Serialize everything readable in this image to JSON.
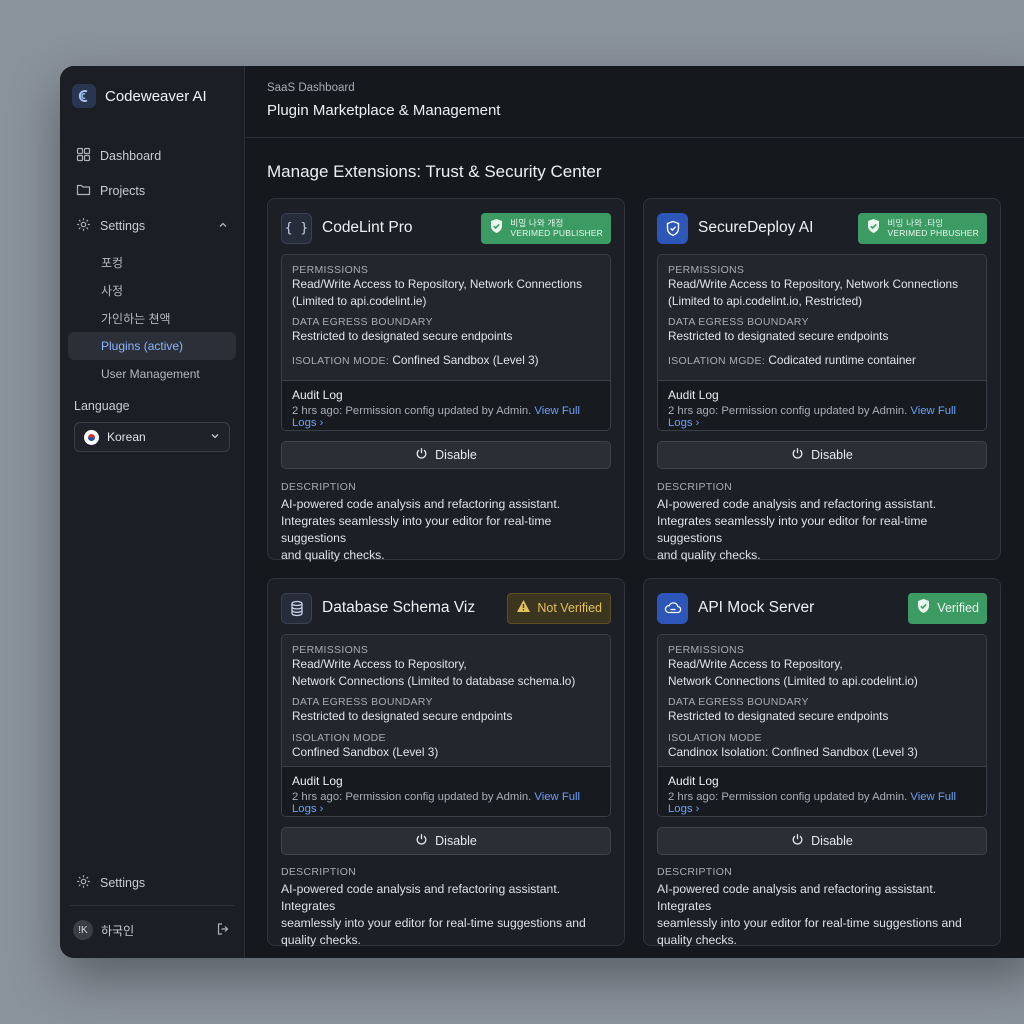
{
  "app": {
    "name": "Codeweaver AI"
  },
  "sidebar": {
    "nav": [
      {
        "label": "Dashboard",
        "icon": "grid-icon"
      },
      {
        "label": "Projects",
        "icon": "folder-icon"
      },
      {
        "label": "Settings",
        "icon": "gear-icon"
      }
    ],
    "sub_items": [
      {
        "label": "포컹"
      },
      {
        "label": "사정"
      },
      {
        "label": "가인하는 쳔액"
      },
      {
        "label": "Plugins (active)",
        "active": true
      },
      {
        "label": "User Management"
      }
    ],
    "language_label": "Language",
    "language_value": "Korean",
    "bottom_settings": "Settings",
    "user_initial": "!K",
    "user_name": "하국인"
  },
  "header": {
    "breadcrumb": "SaaS Dashboard",
    "title": "Plugin Marketplace & Management"
  },
  "section_title": "Manage Extensions: Trust & Security Center",
  "cards": [
    {
      "name": "CodeLint Pro",
      "icon": "braces-icon",
      "badge_type": "ok",
      "badge_line1": "비밀 나와 개정",
      "badge_line2": "VERIMED PUBLISHER",
      "permissions_label": "PERMISSIONS",
      "permissions_line1": "Read/Write Access to Repository, Network Connections",
      "permissions_line2": "(Limited to api.codelint.ie)",
      "egress_label": "DATA EGRESS BOUNDARY",
      "egress_value": "Restricted to designated secure endpoints",
      "isolation_label": "ISOLATION MODE:",
      "isolation_value": "Confined Sandbox (Level 3)",
      "audit_title": "Audit Log",
      "audit_text": "2 hrs ago: Permission config updated by Admin.",
      "audit_link": "View Full Logs",
      "disable_label": "Disable",
      "desc_label": "DESCRIPTION",
      "desc_line1": "AI-powered code analysis and refactoring assistant.",
      "desc_line2": "Integrates seamlessly into your editor for real-time suggestions",
      "desc_line3": "and quality checks."
    },
    {
      "name": "SecureDeploy AI",
      "icon": "shield-icon",
      "badge_type": "ok",
      "badge_line1": "비밍 나와 .타잉",
      "badge_line2": "VERIMED PHBUSHER",
      "permissions_label": "PERMISSIONS",
      "permissions_line1": "Read/Write Access to Repository, Network Connections",
      "permissions_line2": "(Limited to api.codelint.io, Restricted)",
      "egress_label": "DATA EGRESS BOUNDARY",
      "egress_value": "Restricted to designated secure endpoints",
      "isolation_label": "ISOLATION MGDE:",
      "isolation_value": "Codicated runtime container",
      "audit_title": "Audit Log",
      "audit_text": "2 hrs ago: Permission config updated by Admin.",
      "audit_link": "View Full Logs",
      "disable_label": "Disable",
      "desc_label": "DESCRIPTION",
      "desc_line1": "AI-powered code analysis and refactoring assistant.",
      "desc_line2": "Integrates seamlessly into your editor for real-time suggestions",
      "desc_line3": "and quality checks."
    },
    {
      "name": "Database Schema Viz",
      "icon": "database-icon",
      "badge_type": "warn",
      "badge_label": "Not Verified",
      "permissions_label": "PERMISSIONS",
      "permissions_line1": "Read/Write Access to Repository,",
      "permissions_line2": "Network Connections (Limited to database schema.lo)",
      "egress_label": "DATA EGRESS BOUNDARY",
      "egress_value": "Restricted to designated secure endpoints",
      "isolation_label": "ISOLATION MODE",
      "isolation_value": "Confined Sandbox (Level 3)",
      "audit_title": "Audit Log",
      "audit_text": "2 hrs ago: Permission config updated by Admin.",
      "audit_link": "View Full Logs",
      "disable_label": "Disable",
      "desc_label": "DESCRIPTION",
      "desc_line1": "AI-powered code analysis and refactoring assistant. Integrates",
      "desc_line2": "seamlessly into your editor for real-time suggestions and",
      "desc_line3": "quality checks."
    },
    {
      "name": "API Mock Server",
      "icon": "cloud-icon",
      "badge_type": "ok",
      "badge_label": "Verified",
      "permissions_label": "PERMISSIONS",
      "permissions_line1": "Read/Write Access to Repository,",
      "permissions_line2": "Network Connections (Limited to api.codelint.io)",
      "egress_label": "DATA EGRESS BOUNDARY",
      "egress_value": "Restricted to designated secure endpoints",
      "isolation_label": "ISOLATION MODE",
      "isolation_value": "Candinox Isolation: Confined Sandbox (Level 3)",
      "audit_title": "Audit Log",
      "audit_text": "2 hrs ago: Permission config updated by Admin.",
      "audit_link": "View Full Logs",
      "disable_label": "Disable",
      "desc_label": "DESCRIPTION",
      "desc_line1": "AI-powered code analysis and refactoring assistant. Integrates",
      "desc_line2": "seamlessly into your editor for real-time suggestions and",
      "desc_line3": "quality checks."
    }
  ],
  "colors": {
    "accent": "#6fa0f5",
    "verified": "#3c9b63",
    "warning": "#e3c25a"
  }
}
